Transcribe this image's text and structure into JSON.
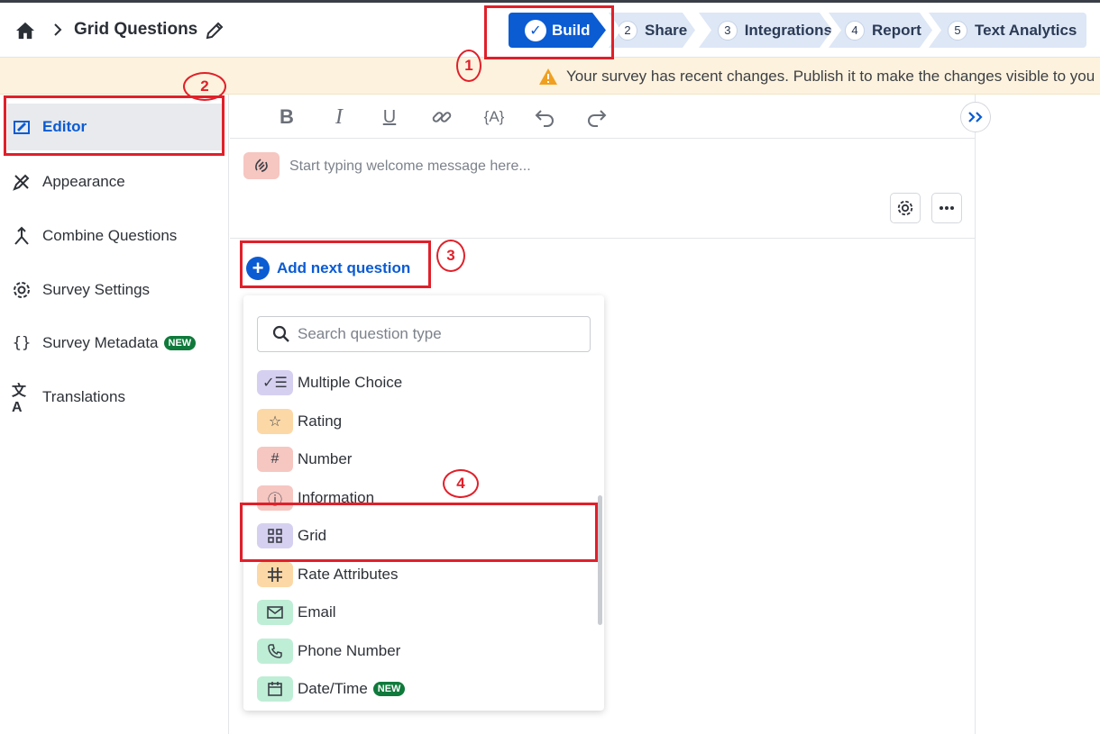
{
  "header": {
    "title": "Grid Questions",
    "steps": [
      {
        "num": "",
        "label": "Build"
      },
      {
        "num": "2",
        "label": "Share"
      },
      {
        "num": "3",
        "label": "Integrations"
      },
      {
        "num": "4",
        "label": "Report"
      },
      {
        "num": "5",
        "label": "Text Analytics"
      }
    ],
    "active_step_color": "#0b5bd3"
  },
  "banner": {
    "text": "Your survey has recent changes. Publish it to make the changes visible to you"
  },
  "sidebar": {
    "items": [
      {
        "label": "Editor",
        "icon": "editor-icon",
        "active": true
      },
      {
        "label": "Appearance",
        "icon": "appearance-icon"
      },
      {
        "label": "Combine Questions",
        "icon": "combine-icon"
      },
      {
        "label": "Survey Settings",
        "icon": "gear-icon"
      },
      {
        "label": "Survey Metadata",
        "icon": "braces-icon",
        "badge": "NEW"
      },
      {
        "label": "Translations",
        "icon": "translate-icon"
      }
    ]
  },
  "toolbar": {
    "bold": "B",
    "italic": "I",
    "underline": "U",
    "variable": "{A}"
  },
  "welcome": {
    "placeholder": "Start typing welcome message here..."
  },
  "add_question": {
    "label": "Add next question"
  },
  "question_types": {
    "search_placeholder": "Search question type",
    "items": [
      {
        "label": "Multiple Choice",
        "icon": "checklist-icon",
        "color": "#d6d0f0"
      },
      {
        "label": "Rating",
        "icon": "star-icon",
        "color": "#fcd8a6"
      },
      {
        "label": "Number",
        "icon": "hash-icon",
        "color": "#f6c6c1"
      },
      {
        "label": "Information",
        "icon": "info-icon",
        "color": "#f6c6c1"
      },
      {
        "label": "Grid",
        "icon": "grid-icon",
        "color": "#d6d0f0"
      },
      {
        "label": "Rate Attributes",
        "icon": "rate-grid-icon",
        "color": "#fcd8a6"
      },
      {
        "label": "Email",
        "icon": "mail-icon",
        "color": "#bfeed6"
      },
      {
        "label": "Phone Number",
        "icon": "phone-icon",
        "color": "#bfeed6"
      },
      {
        "label": "Date/Time",
        "icon": "calendar-icon",
        "color": "#bfeed6",
        "badge": "NEW"
      }
    ]
  },
  "annotations": [
    "1",
    "2",
    "3",
    "4"
  ]
}
